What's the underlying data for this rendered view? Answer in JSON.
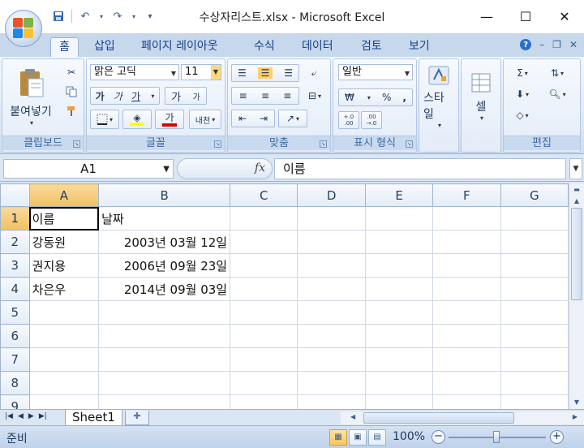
{
  "window": {
    "title": "수상자리스트.xlsx - Microsoft Excel"
  },
  "ribbon": {
    "tabs": [
      "홈",
      "삽입",
      "페이지 레이아웃",
      "수식",
      "데이터",
      "검토",
      "보기"
    ],
    "active_tab": "홈",
    "groups": {
      "clipboard": {
        "label": "클립보드",
        "paste_label": "붙여넣기"
      },
      "font": {
        "label": "글꼴",
        "font_name": "맑은 고딕",
        "font_size": "11",
        "bold": "가",
        "italic": "가",
        "underline": "가",
        "grow": "가",
        "shrink": "가",
        "font_color": "가",
        "phonetic": "내천"
      },
      "alignment": {
        "label": "맞춤"
      },
      "number": {
        "label": "표시 형식",
        "format": "일반",
        "currency": "₩",
        "percent": "%",
        "comma": ",",
        "inc_decimal": "+.0 .00",
        "dec_decimal": ".00 →.0"
      },
      "styles": {
        "label": "스타일"
      },
      "cells": {
        "label": "셀"
      },
      "editing": {
        "label": "편집"
      }
    }
  },
  "formula_bar": {
    "name_box": "A1",
    "fx": "fx",
    "content": "이름"
  },
  "sheet": {
    "columns": [
      "A",
      "B",
      "C",
      "D",
      "E",
      "F",
      "G"
    ],
    "rows": [
      {
        "num": "1",
        "cells": [
          "이름",
          "날짜",
          "",
          "",
          "",
          "",
          ""
        ]
      },
      {
        "num": "2",
        "cells": [
          "강동원",
          "2003년 03월 12일",
          "",
          "",
          "",
          "",
          ""
        ]
      },
      {
        "num": "3",
        "cells": [
          "권지용",
          "2006년 09월 23일",
          "",
          "",
          "",
          "",
          ""
        ]
      },
      {
        "num": "4",
        "cells": [
          "차은우",
          "2014년 09월 03일",
          "",
          "",
          "",
          "",
          ""
        ]
      },
      {
        "num": "5",
        "cells": [
          "",
          "",
          "",
          "",
          "",
          "",
          ""
        ]
      },
      {
        "num": "6",
        "cells": [
          "",
          "",
          "",
          "",
          "",
          "",
          ""
        ]
      },
      {
        "num": "7",
        "cells": [
          "",
          "",
          "",
          "",
          "",
          "",
          ""
        ]
      },
      {
        "num": "8",
        "cells": [
          "",
          "",
          "",
          "",
          "",
          "",
          ""
        ]
      },
      {
        "num": "9",
        "cells": [
          "",
          "",
          "",
          "",
          "",
          "",
          ""
        ]
      }
    ],
    "tab_name": "Sheet1"
  },
  "status": {
    "mode": "준비",
    "zoom": "100%"
  },
  "colors": {
    "accent": "#ffc75a",
    "ribbon_bg": "#dbe7f6",
    "grid_line": "#d0d7e5"
  }
}
